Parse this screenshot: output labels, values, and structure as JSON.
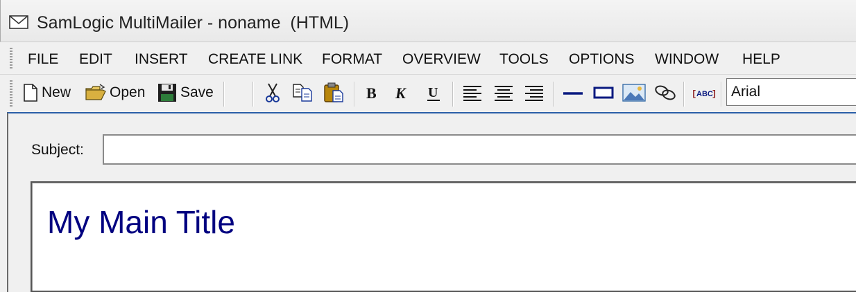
{
  "window": {
    "title": "SamLogic MultiMailer - noname  (HTML)"
  },
  "menu": [
    "FILE",
    "EDIT",
    "INSERT",
    "CREATE LINK",
    "FORMAT",
    "OVERVIEW",
    "TOOLS",
    "OPTIONS",
    "WINDOW",
    "HELP"
  ],
  "toolbar": {
    "new_label": "New",
    "open_label": "Open",
    "save_label": "Save",
    "font_name": "Arial"
  },
  "compose": {
    "subject_label": "Subject:",
    "subject_value": "",
    "body_title": "My Main Title"
  },
  "colors": {
    "body_title_color": "#000080",
    "accent_border": "#2a5fa8"
  }
}
